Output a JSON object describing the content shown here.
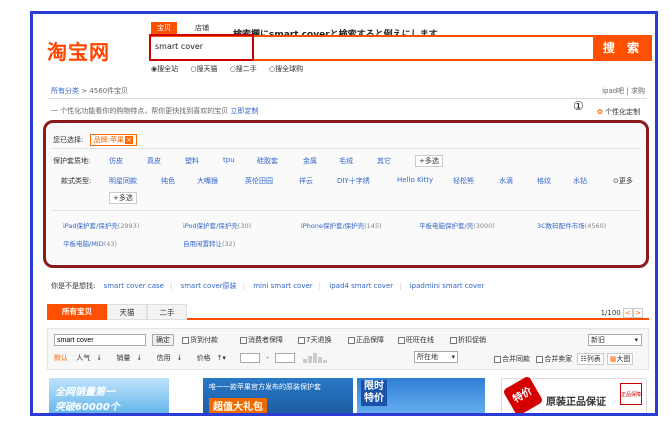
{
  "header": {
    "logo": "淘宝网",
    "search_tabs": [
      "宝贝",
      "店铺"
    ],
    "annotation": "検索欄にsmart coverと検索すると例えにします。",
    "search_value": "smart cover",
    "search_button": "搜 索",
    "scope_options": [
      "◉搜全站",
      "○搜天猫",
      "○搜二手",
      "○搜全球购"
    ]
  },
  "breadcrumb": {
    "root": "所有分类",
    "sep": " > ",
    "count": "4560件宝贝"
  },
  "top_right": "ipad吧 | 求购",
  "tip": {
    "text": "一 个性化功能看你的购物特点，帮你更快找到喜欢的宝贝",
    "link": "立即定制"
  },
  "marker": "①",
  "custom_label": "个性化定制",
  "filters": {
    "selected_label": "您已选择:",
    "selected_chip": "品牌:苹果",
    "material_label": "保护套质地:",
    "materials": [
      "仿皮",
      "真皮",
      "塑料",
      "tpu",
      "硅胶套",
      "金属",
      "毛绒",
      "其它"
    ],
    "multi": "+多选",
    "style_label": "款式类型:",
    "styles": [
      "明星同款",
      "纯色",
      "大嘴猴",
      "英伦田园",
      "祥云",
      "DIY十字绣",
      "Hello Kitty",
      "轻松熊",
      "水滴",
      "格纹",
      "水钻"
    ],
    "more": "更多",
    "categories": [
      {
        "name": "iPad保护套/保护壳",
        "count": "(2993)"
      },
      {
        "name": "iPod保护套/保护壳",
        "count": "(30)"
      },
      {
        "name": "iPhone保护套/保护壳",
        "count": "(145)"
      },
      {
        "name": "平板电脑保护套/壳",
        "count": "(3000)"
      },
      {
        "name": "3C数码配件市场",
        "count": "(4560)"
      },
      {
        "name": "平板电脑/MID",
        "count": "(43)"
      },
      {
        "name": "自用闲置转让",
        "count": "(32)"
      }
    ]
  },
  "suggest": {
    "label": "你是不是想找:",
    "items": [
      "smart cover case",
      "smart cover原装",
      "mini smart cover",
      "ipad4 smart cover",
      "ipadmini smart cover"
    ]
  },
  "result_tabs": [
    "所有宝贝",
    "天猫",
    "二手"
  ],
  "pager": {
    "text": "1/100",
    "prev": "<",
    "next": ">"
  },
  "toolbar": {
    "input_value": "smart cover",
    "ok": "确定",
    "checks": [
      "货到付款",
      "消费者保障",
      "7天退换",
      "正品保障",
      "旺旺在线",
      "折扣促销"
    ],
    "sort_select": "新旧",
    "sorts": [
      "默认",
      "人气",
      "销量",
      "信用",
      "价格"
    ],
    "range_sep": "-",
    "location": "所在地",
    "right_checks": [
      "合并同款",
      "合并卖家"
    ],
    "view_list": "列表",
    "view_grid": "大图"
  },
  "ads": {
    "a1_line1": "全网销量第一",
    "a1_line2": "突破60000个",
    "a2_line1": "唯一一款苹果官方发布的原装保护套",
    "a2_line2": "超值大礼包",
    "a3_line1": "限时",
    "a3_line2": "特价",
    "a4_badge": "特价",
    "a4_text": "原装正品保证",
    "a4_seal": "正品保障"
  },
  "colors": {
    "accent": "#ff5000",
    "frame": "#2a3bd6",
    "filter_border": "#8b1a1a",
    "link": "#3366cc"
  }
}
